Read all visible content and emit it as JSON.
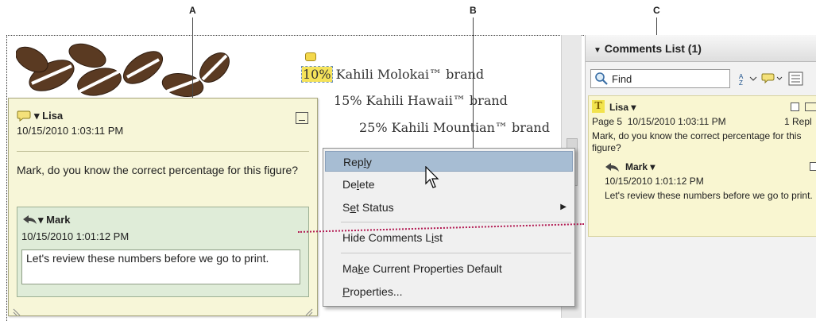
{
  "callouts": {
    "a": "A",
    "b": "B",
    "c": "C"
  },
  "document": {
    "lines": [
      "Kahili Molokai™ brand",
      "15% Kahili Hawaii™ brand",
      "25% Kahili Mountian™ brand"
    ],
    "highlight_text": "10%"
  },
  "popup": {
    "author": "Lisa",
    "date": "10/15/2010 1:03:11 PM",
    "body": "Mark, do you know the correct percentage for this figure?",
    "reply": {
      "author": "Mark",
      "date": "10/15/2010 1:01:12 PM",
      "text": "Let's review these numbers before we go to print."
    }
  },
  "context_menu": {
    "items": [
      {
        "pre": "Rep",
        "key": "l",
        "post": "y"
      },
      {
        "pre": "De",
        "key": "l",
        "post": "ete"
      },
      {
        "pre": "S",
        "key": "e",
        "post": "t Status"
      },
      {
        "pre": "Hide Comments L",
        "key": "i",
        "post": "st"
      },
      {
        "pre": "Ma",
        "key": "k",
        "post": "e Current Properties Default"
      },
      {
        "pre": "",
        "key": "P",
        "post": "roperties..."
      }
    ]
  },
  "comments_panel": {
    "title": "Comments List (1)",
    "find_placeholder": "Find",
    "entry": {
      "badge": "T",
      "author": "Lisa",
      "page": "Page 5",
      "date": "10/15/2010 1:03:11 PM",
      "replies": "1 Repl",
      "body": "Mark, do you know the correct percentage for this figure?",
      "reply": {
        "author": "Mark",
        "date": "10/15/2010 1:01:12 PM",
        "text": "Let's review these numbers before we go to print."
      }
    }
  },
  "colors": {
    "highlight": "#f5e35a",
    "popup_bg": "#f7f6d8",
    "reply_bg": "#dfecd8",
    "menu_hover": "#a7bdd3",
    "leader_dots": "#b21a52"
  }
}
